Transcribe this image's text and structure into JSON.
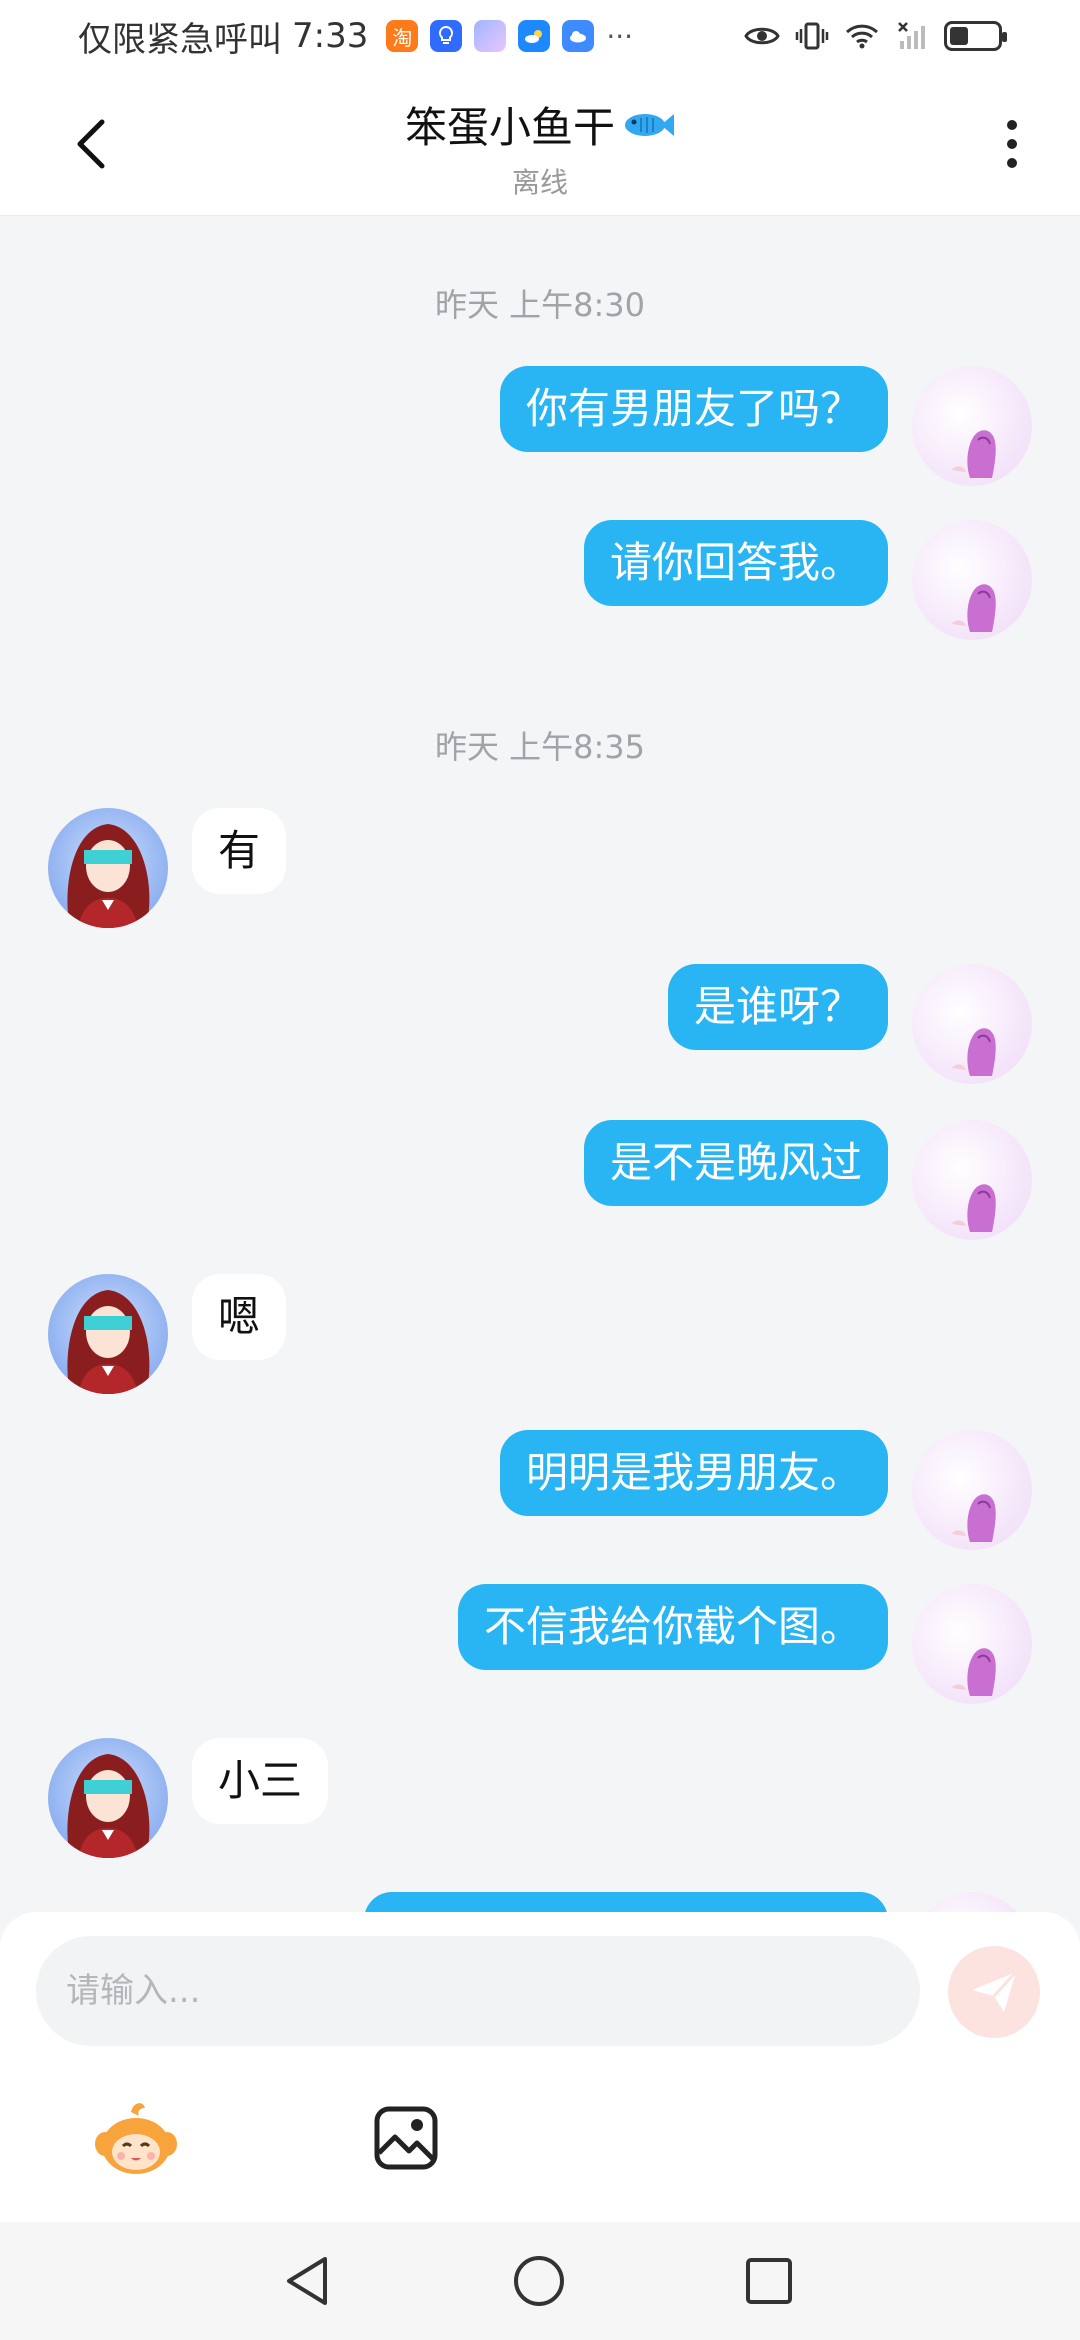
{
  "status_bar": {
    "carrier_text": "仅限紧急呼叫",
    "time": "7:33",
    "overflow": "···",
    "notification_icons": [
      "taobao-icon",
      "lightbulb-icon",
      "anime-app-icon",
      "weather-icon",
      "cloud-icon"
    ],
    "system_icons": [
      "eye-icon",
      "vibrate-icon",
      "wifi-icon",
      "no-signal-icon",
      "battery-icon"
    ],
    "battery_level": 0.35
  },
  "header": {
    "title": "笨蛋小鱼干",
    "title_emoji": "🐟",
    "status": "离线",
    "back_icon": "chevron-left-icon",
    "more_icon": "more-vertical-icon"
  },
  "messages": {
    "timestamps": [
      "昨天 上午8:30",
      "昨天 上午8:35"
    ],
    "items": [
      {
        "dir": "out",
        "text": "你有男朋友了吗？"
      },
      {
        "dir": "out",
        "text": "请你回答我。"
      },
      {
        "dir": "in",
        "text": "有"
      },
      {
        "dir": "out",
        "text": "是谁呀？"
      },
      {
        "dir": "out",
        "text": "是不是晚风过"
      },
      {
        "dir": "in",
        "text": "嗯"
      },
      {
        "dir": "out",
        "text": "明明是我男朋友。"
      },
      {
        "dir": "out",
        "text": "不信我给你截个图。"
      },
      {
        "dir": "in",
        "text": "小三"
      },
      {
        "dir": "out",
        "text": ""
      }
    ]
  },
  "input": {
    "placeholder": "请输入...",
    "value": "",
    "send_icon": "send-icon",
    "tools": [
      "mascot-emoji-icon",
      "image-icon"
    ]
  },
  "nav_bar": {
    "buttons": [
      "back-triangle-icon",
      "home-circle-icon",
      "recents-square-icon"
    ]
  },
  "colors": {
    "accent": "#29b5f3",
    "background": "#f4f5f7",
    "send_button": "#fde3df"
  }
}
